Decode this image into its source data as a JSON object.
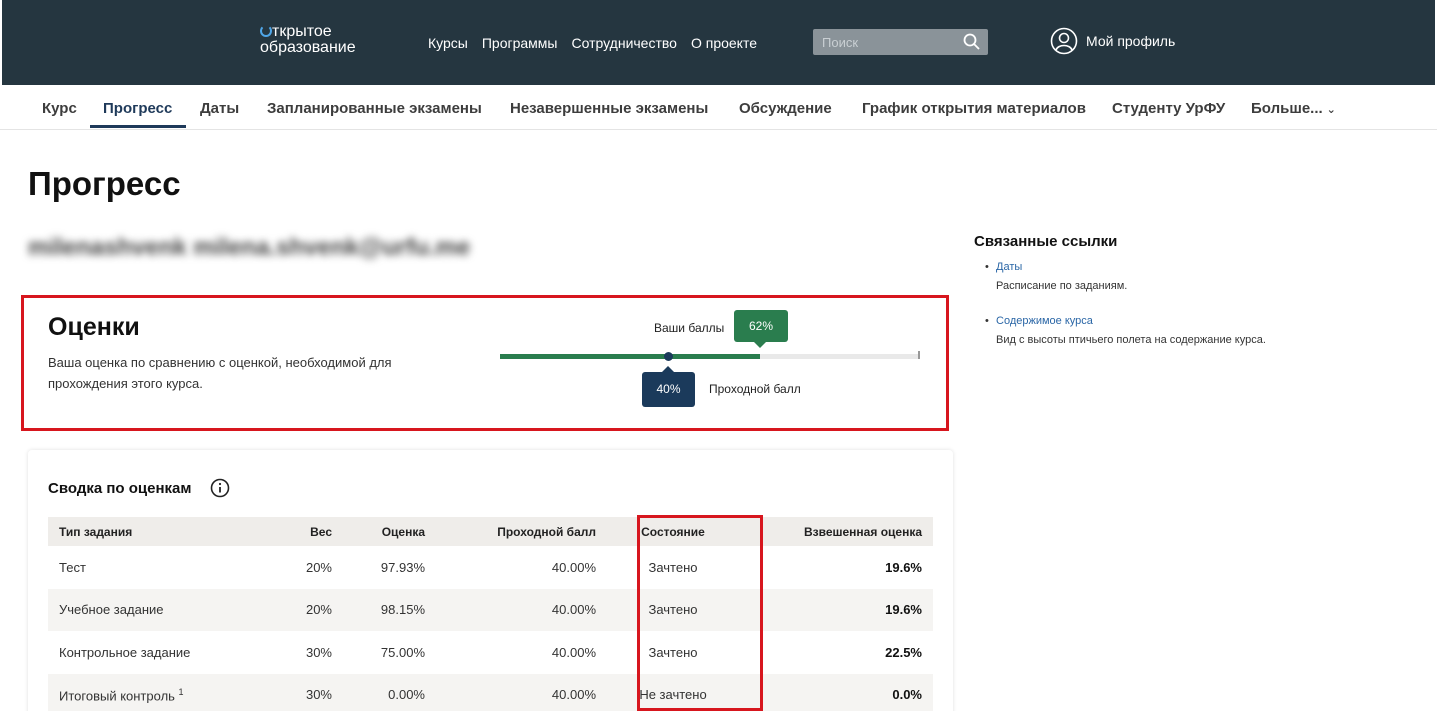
{
  "header": {
    "logo_line1": "ткрытое",
    "logo_line2": "образование",
    "nav": [
      "Курсы",
      "Программы",
      "Сотрудничество",
      "О проекте"
    ],
    "search_placeholder": "Поиск",
    "profile_label": "Мой профиль",
    "bg_color": "#253640"
  },
  "tabs": {
    "items": [
      "Курс",
      "Прогресс",
      "Даты",
      "Запланированные экзамены",
      "Незавершенные экзамены",
      "Обсуждение",
      "График открытия материалов",
      "Студенту УрФУ",
      "Больше..."
    ],
    "active": "Прогресс"
  },
  "page": {
    "title": "Прогресс",
    "user": "milenashvenk milena.shvenk@urfu.me"
  },
  "grades": {
    "title": "Оценки",
    "description": "Ваша оценка по сравнению с оценкой, необходимой для прохождения этого курса.",
    "your_label": "Ваши баллы",
    "your_value": "62%",
    "your_fraction": 0.62,
    "pass_label": "Проходной балл",
    "pass_value": "40%",
    "pass_fraction": 0.4,
    "accent_color": "#2a7d4e",
    "pass_color": "#1b3a5b"
  },
  "summary": {
    "title": "Сводка по оценкам",
    "headers": [
      "Тип задания",
      "Вес",
      "Оценка",
      "Проходной балл",
      "Состояние",
      "Взвешенная оценка"
    ],
    "rows": [
      {
        "type": "Тест",
        "sup": "",
        "weight": "20%",
        "grade": "97.93%",
        "pass": "40.00%",
        "state": "Зачтено",
        "weighted": "19.6%"
      },
      {
        "type": "Учебное задание",
        "sup": "",
        "weight": "20%",
        "grade": "98.15%",
        "pass": "40.00%",
        "state": "Зачтено",
        "weighted": "19.6%"
      },
      {
        "type": "Контрольное задание",
        "sup": "",
        "weight": "30%",
        "grade": "75.00%",
        "pass": "40.00%",
        "state": "Зачтено",
        "weighted": "22.5%"
      },
      {
        "type": "Итоговый контроль",
        "sup": "1",
        "weight": "30%",
        "grade": "0.00%",
        "pass": "40.00%",
        "state": "Не зачтено",
        "weighted": "0.0%"
      }
    ]
  },
  "related": {
    "title": "Связанные ссылки",
    "links": [
      {
        "label": "Даты",
        "desc": "Расписание по заданиям."
      },
      {
        "label": "Содержимое курса",
        "desc": "Вид с высоты птичьего полета на содержание курса."
      }
    ]
  },
  "highlight_color": "#d7161e"
}
